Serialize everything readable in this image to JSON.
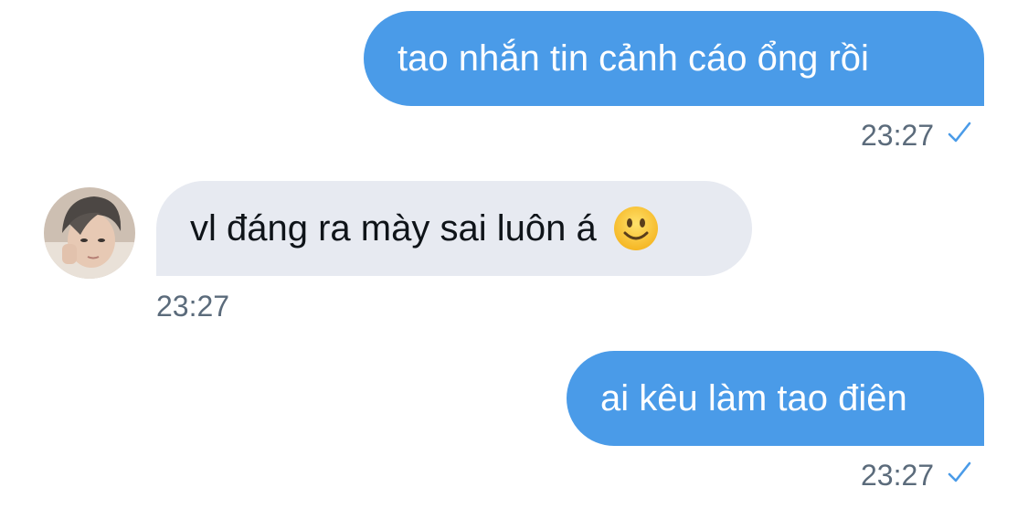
{
  "messages": [
    {
      "direction": "outgoing",
      "text": "tao nhắn tin cảnh cáo ổng rồi",
      "time": "23:27",
      "status_icon": "check-icon"
    },
    {
      "direction": "incoming",
      "text": "vl đáng ra mày sai luôn á",
      "emoji": "slightly-smiling-face-icon",
      "time": "23:27",
      "avatar_icon": "avatar"
    },
    {
      "direction": "outgoing",
      "text": "ai kêu làm tao điên",
      "time": "23:27",
      "status_icon": "check-icon"
    }
  ],
  "colors": {
    "outgoing_bubble": "#4a9be8",
    "incoming_bubble": "#e7eaf1",
    "timestamp": "#5b6b7b",
    "check": "#4a9be8"
  }
}
